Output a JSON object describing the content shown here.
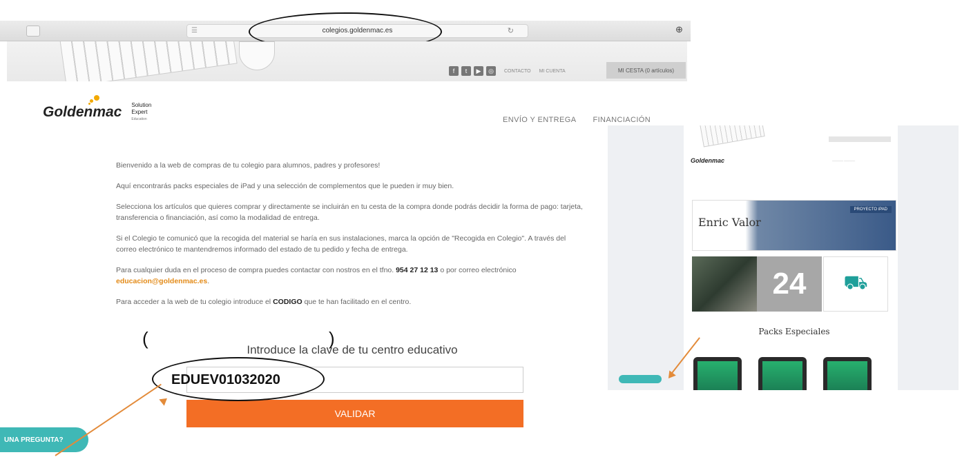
{
  "browser": {
    "url": "colegios.goldenmac.es",
    "reader_glyph": "☰",
    "reload_glyph": "↻",
    "share_glyph": "⊕"
  },
  "header": {
    "social_icons": [
      "facebook-icon",
      "twitter-icon",
      "youtube-icon",
      "instagram-icon"
    ],
    "contact_label": "CONTACTO",
    "account_label": "MI CUENTA",
    "cart_label": "MI CESTA (0 artículos)"
  },
  "logo": {
    "brand": "Goldenmac",
    "apple_glyph": "",
    "badge_line1": "Solution",
    "badge_line2": "Expert",
    "badge_line3": "Education"
  },
  "nav": {
    "items": [
      "ENVÍO Y ENTREGA",
      "FINANCIACIÓN"
    ]
  },
  "content": {
    "p1": "Bienvenido a la web de compras de tu colegio para alumnos, padres y profesores!",
    "p2": "Aquí encontrarás packs especiales de iPad y una selección de complementos que le pueden ir muy bien.",
    "p3": "Selecciona los artículos que quieres comprar y directamente se incluirán en tu cesta de la compra donde podrás decidir la forma de pago: tarjeta, transferencia o financiación, así como la modalidad de entrega.",
    "p4": "Si el Colegio te comunicó que la recogida del material se haría en sus instalaciones, marca la opción de \"Recogida en Colegio\". A través del correo electrónico te mantendremos informado del estado de tu pedido y fecha de entrega.",
    "p5_before": "Para cualquier duda en el proceso de compra puedes contactar con nostros en el tfno. ",
    "p5_phone": "954 27 12 13",
    "p5_middle": " o por correo electrónico ",
    "p5_email": "educacion@goldenmac.es",
    "p5_after": ".",
    "p6_before": "Para acceder a la web de tu colegio introduce el ",
    "p6_code": "CODIGO",
    "p6_after": " que te han facilitado en el centro."
  },
  "form": {
    "title": "Introduce la clave de tu centro educativo",
    "code_value": "EDUEV01032020",
    "paren_open": "(",
    "paren_close": ")",
    "submit_label": "VALIDAR"
  },
  "chat": {
    "label": "UNA PREGUNTA?"
  },
  "mini": {
    "logo": "Goldenmac ",
    "banner_logo": "Enric Valor",
    "banner_tag": "PROYECTO iPAD",
    "tile_number": "24",
    "truck_glyph": "⛟",
    "packs_title": "Packs Especiales"
  },
  "colors": {
    "accent_orange": "#f36e25",
    "chat_teal": "#3fb8b6",
    "email_orange": "#e38b19"
  }
}
